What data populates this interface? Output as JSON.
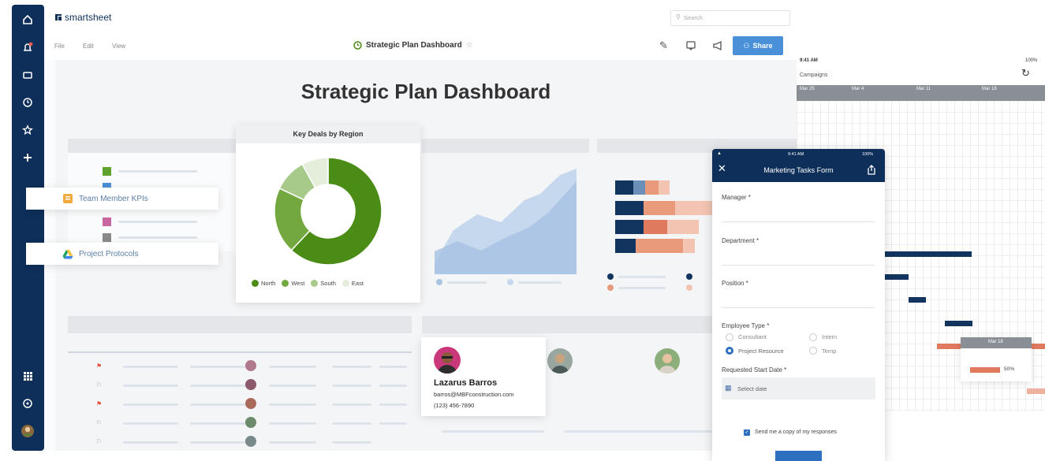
{
  "app": {
    "brand": "smartsheet",
    "menu": [
      "File",
      "Edit",
      "View"
    ],
    "doc_title": "Strategic Plan Dashboard",
    "search_placeholder": "Search",
    "share_label": "Share"
  },
  "dashboard": {
    "heading": "Strategic Plan Dashboard",
    "team_kpis_label": "Team Member KPIs",
    "project_protocols_label": "Project Protocols",
    "donut": {
      "title": "Key Deals by Region",
      "legend": [
        "North",
        "West",
        "South",
        "East"
      ]
    },
    "contact": {
      "name": "Lazarus Barros",
      "email": "barros@MBFconstruction.com",
      "phone": "(123) 456-7890"
    }
  },
  "chart_data": {
    "type": "pie",
    "title": "Key Deals by Region",
    "categories": [
      "North",
      "West",
      "South",
      "East"
    ],
    "values": [
      62,
      20,
      10,
      8
    ],
    "colors": [
      "#4b8c16",
      "#72a83f",
      "#a7c98a",
      "#e4eedb"
    ]
  },
  "gantt": {
    "time": "9:41 AM",
    "battery": "100%",
    "row_label": "Campaigns",
    "weeks": [
      "Mar 25",
      "Mar 4",
      "Mar 11",
      "Mar 18"
    ],
    "popup_week": "Mar 18",
    "popup_percent": "50%"
  },
  "form": {
    "time": "9:41 AM",
    "battery": "100%",
    "title": "Marketing Tasks Form",
    "fields": {
      "manager": "Manager *",
      "department": "Department *",
      "position": "Position *",
      "employee_type": "Employee Type *",
      "start_date": "Requested Start Date *"
    },
    "employee_types": [
      "Consultant",
      "Intern",
      "Project Resource",
      "Temp"
    ],
    "selected_type": "Project Resource",
    "date_placeholder": "Select date",
    "copy_label": "Send me a copy of my responses",
    "copy_checked": true
  },
  "colors": {
    "sidebar": "#0e2f5a",
    "share_button": "#4a90d9",
    "donut_green": "#4b8c16",
    "gantt_bar": "#12355f",
    "gantt_orange": "#e07a5f"
  }
}
